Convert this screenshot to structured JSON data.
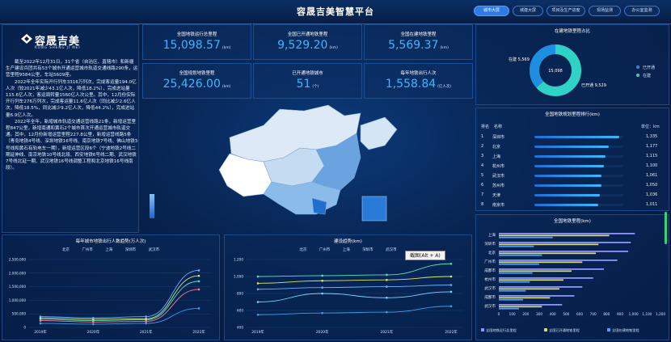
{
  "header": {
    "title": "容晟吉美智慧平台",
    "nav": [
      "城市大屏",
      "城建大屏",
      "项目及生产进度",
      "现场监测",
      "办公室监测"
    ]
  },
  "logo": {
    "name": "容晟吉美",
    "sub": "RONG SHENG JI MEI"
  },
  "intro": {
    "paragraphs": [
      "截至2022年12月31日，31个省（自治区、直辖市）和新疆生产建设兵团共有53个城市开通运营城市轨道交通线路290条，运营里程9584公里，车站5609座。",
      "2022年全年实际开行列车3316万列次，完成客运量194.0亿人次（较2021年减少43.1亿人次，降低18.2%），完成进站量115.6亿人次，客运周转量1560亿人次公里。其中，12月份实际开行列车276万列次，完成客运量11.6亿人次（同比减少2.6亿人次，降低18.5%，同比减少9.2亿人次，降低44.2%），完成进站量6.9亿人次。",
      "2022年全年，新增城市轨道交通运营线路21条，新增运营里程847公里，新增南通和黄石2个城市首次开通运营城市轨道交通。其中，12月份新增运营里程227.8公里，新增运营线路5条（青岛地铁4号线、深圳地铁16号线、南京地铁7号线、佛山地铁3号线和黄石有轨电车一期），新增运营区段6个（宁波地铁2号线二期延伸线、南京地铁10号线北段、西安地铁6号线二期、武汉地铁7号线北延一期、武汉地铁16号线调整工程和北京地铁16号线南段）。"
    ]
  },
  "stats": [
    {
      "label": "全国地铁运行总里程",
      "value": "15,098.57",
      "unit": "(km)"
    },
    {
      "label": "全国已开通地铁里程",
      "value": "9,529.20",
      "unit": "(km)"
    },
    {
      "label": "全国在建地铁里程",
      "value": "5,569.37",
      "unit": "(km)"
    },
    {
      "label": "全国规划地铁里程",
      "value": "25,426.00",
      "unit": "(km)"
    },
    {
      "label": "已开通地铁城市",
      "value": "51",
      "unit": "(个)"
    },
    {
      "label": "每年地铁出行人次",
      "value": "1,558.84",
      "unit": "(亿人次)"
    }
  ],
  "donut": {
    "title": "在建地铁里程占比",
    "center": "15,098",
    "left_label": "在建 5,569",
    "right_label": "已开通 9,529",
    "legend": [
      "已开通",
      "在建"
    ],
    "opened": 9529,
    "building": 5569,
    "colors": [
      "#2fd3c6",
      "#1e8fe0"
    ]
  },
  "rank": {
    "title": "全国地铁规划里程排行(km)",
    "h_rank": "排名",
    "h_name": "名称",
    "h_unit": "单位：km",
    "rows": [
      {
        "rank": "1",
        "name": "深圳市",
        "value": 1335
      },
      {
        "rank": "2",
        "name": "北京",
        "value": 1177
      },
      {
        "rank": "3",
        "name": "上海",
        "value": 1115
      },
      {
        "rank": "4",
        "name": "杭州市",
        "value": 1100
      },
      {
        "rank": "5",
        "name": "武汉市",
        "value": 1061
      },
      {
        "rank": "6",
        "name": "苏州市",
        "value": 1050
      },
      {
        "rank": "7",
        "name": "天津",
        "value": 1036
      },
      {
        "rank": "8",
        "name": "南京市",
        "value": 1011
      }
    ]
  },
  "hbar": {
    "title": "全国地铁里程(km)",
    "cities": [
      "上海",
      "深圳市",
      "北京",
      "广州市",
      "成都市",
      "杭州市",
      "武汉市",
      "成都市",
      "武汉市"
    ],
    "xticks": [
      "0",
      "100",
      "200",
      "300",
      "400",
      "500",
      "600",
      "700",
      "800",
      "900",
      "1,000",
      "1,100",
      "1,200"
    ],
    "legend": [
      "全国地铁运行总里程",
      "全国已开通地铁里程",
      "全国在建地铁里程"
    ]
  },
  "tooltip": "截图(Alt + A)",
  "chart_data": [
    {
      "type": "line",
      "title": "每年城市地铁出行人数趋势(万人次)",
      "categories": [
        "2019年",
        "2020年",
        "2021年",
        "2022年"
      ],
      "yticks": [
        "2,500,000",
        "2,000,000",
        "1,500,000",
        "1,000,000",
        "500,000",
        "0"
      ],
      "ylim": [
        0,
        2500000
      ],
      "series": [
        {
          "name": "北京",
          "values": [
            300000,
            250000,
            280000,
            1700000
          ]
        },
        {
          "name": "广州市",
          "values": [
            350000,
            300000,
            320000,
            1900000
          ]
        },
        {
          "name": "上海",
          "values": [
            400000,
            350000,
            400000,
            2100000
          ]
        },
        {
          "name": "深圳市",
          "values": [
            250000,
            200000,
            220000,
            1400000
          ]
        },
        {
          "name": "武汉市",
          "values": [
            150000,
            120000,
            150000,
            700000
          ]
        }
      ]
    },
    {
      "type": "line",
      "title": "建设趋势(km)",
      "categories": [
        "2019年",
        "2020年",
        "2021年",
        "2022年"
      ],
      "yticks": [
        "1,200",
        "1,000",
        "800",
        "600",
        "400"
      ],
      "ylim": [
        400,
        1200
      ],
      "series": [
        {
          "name": "北京",
          "values": [
            1000,
            1010,
            1020,
            1150
          ]
        },
        {
          "name": "广州市",
          "values": [
            920,
            950,
            960,
            1000
          ]
        },
        {
          "name": "上海",
          "values": [
            850,
            870,
            880,
            900
          ]
        },
        {
          "name": "深圳市",
          "values": [
            700,
            800,
            750,
            820
          ]
        },
        {
          "name": "武汉市",
          "values": [
            550,
            570,
            580,
            650
          ]
        }
      ]
    }
  ]
}
